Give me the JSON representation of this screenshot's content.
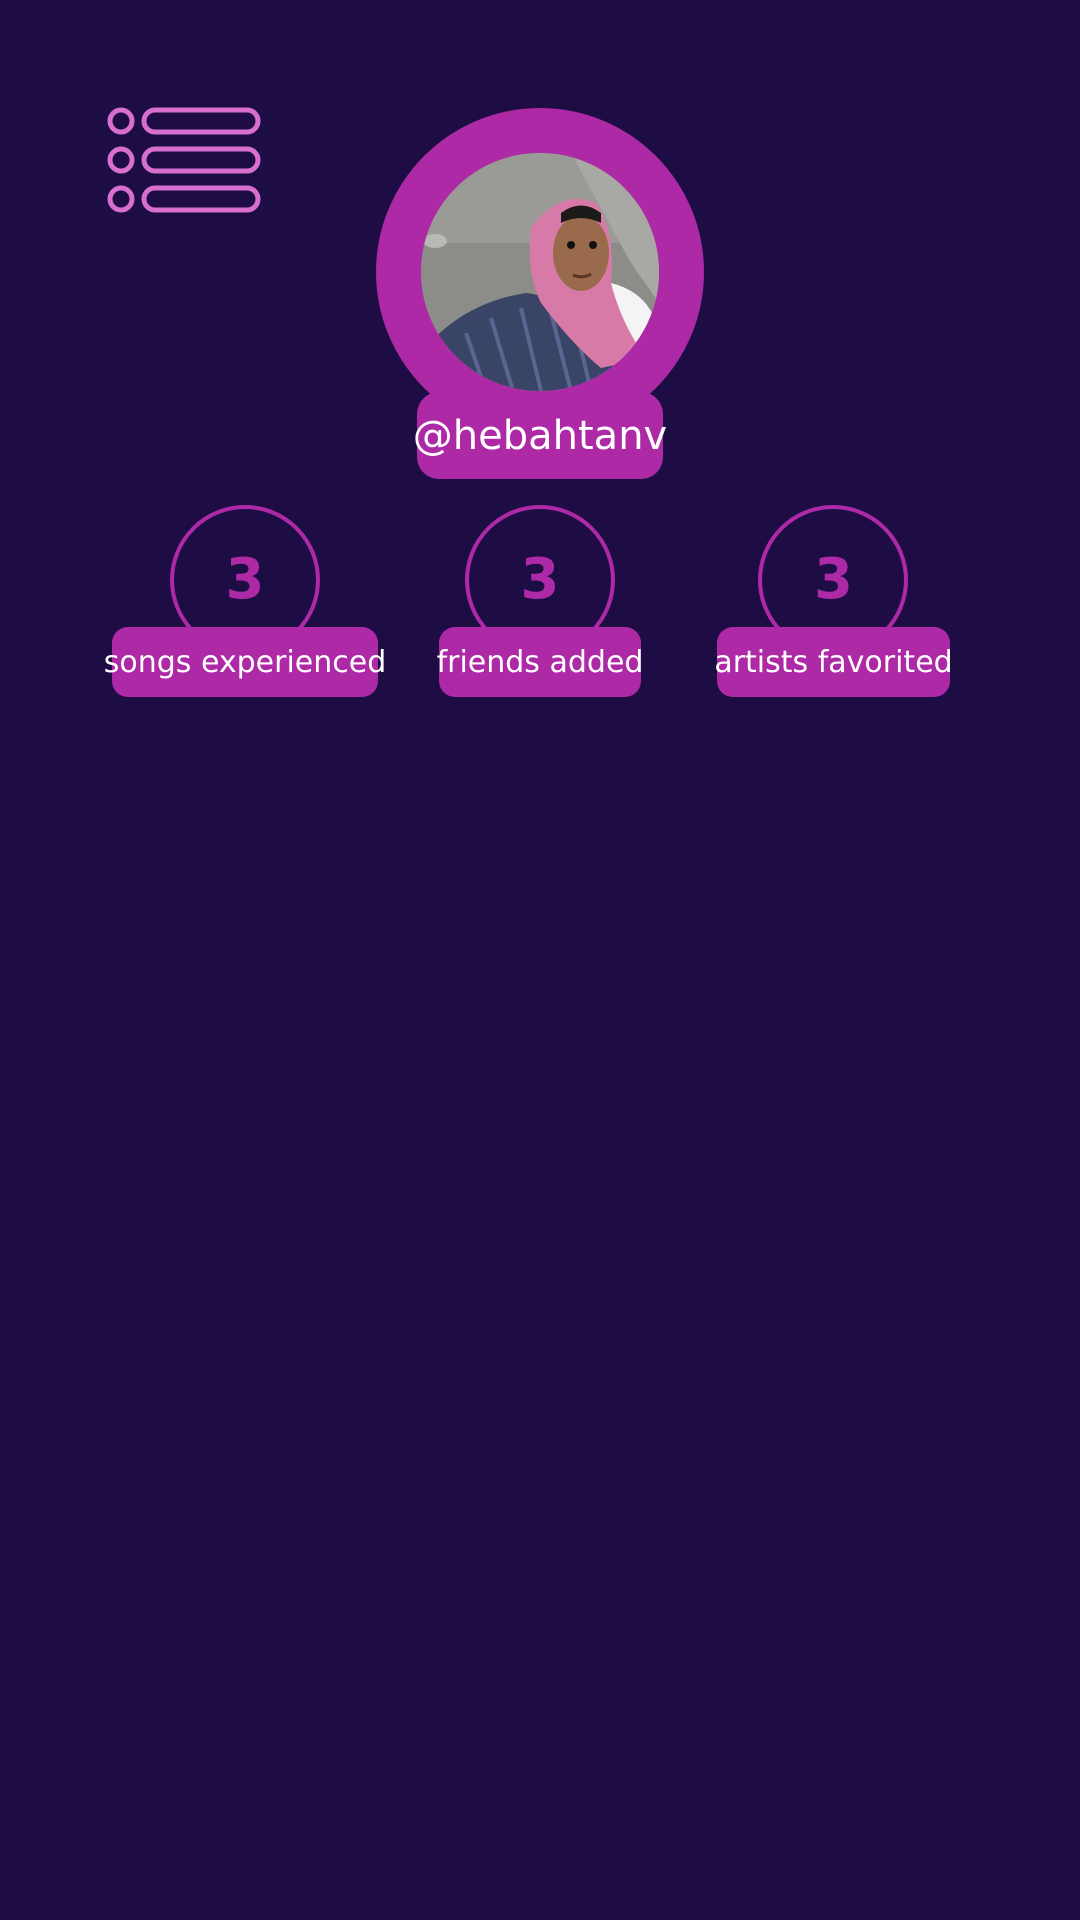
{
  "header": {
    "menu_icon": "list-menu-icon"
  },
  "profile": {
    "avatar": "profile-photo",
    "username": "@hebahtanv"
  },
  "stats": [
    {
      "value": "3",
      "label": "songs experienced"
    },
    {
      "value": "3",
      "label": "friends added"
    },
    {
      "value": "3",
      "label": "artists favorited"
    }
  ],
  "colors": {
    "background": "#1e0d45",
    "accent": "#ad29a6",
    "menu_icon": "#d86fcf",
    "text_on_accent": "#ffffff"
  }
}
